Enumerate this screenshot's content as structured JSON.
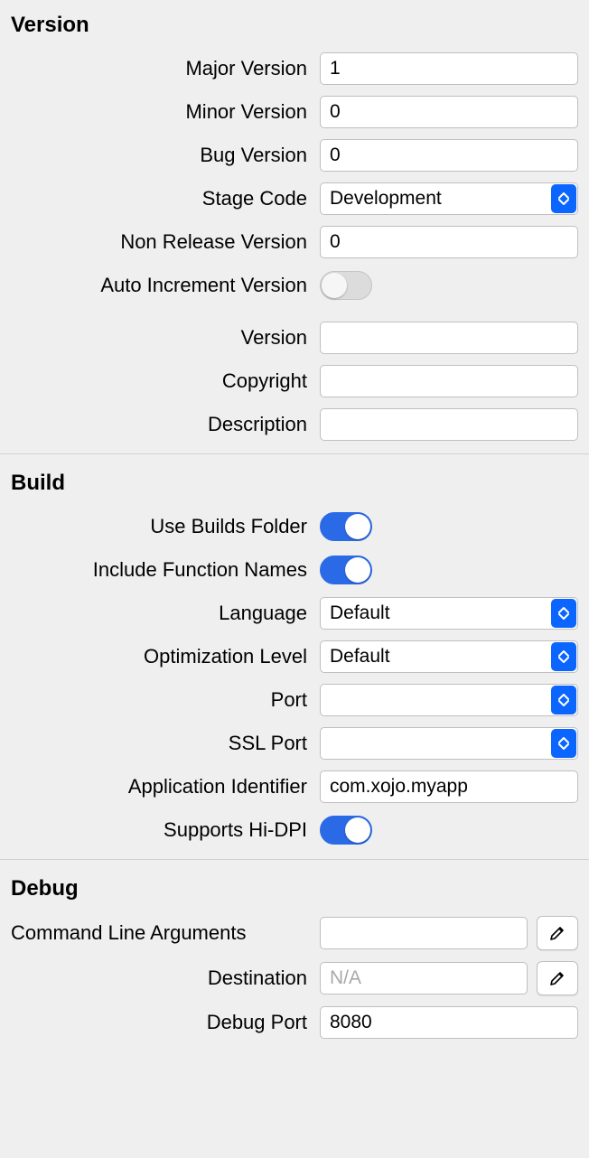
{
  "version": {
    "title": "Version",
    "major_label": "Major Version",
    "major_value": "1",
    "minor_label": "Minor Version",
    "minor_value": "0",
    "bug_label": "Bug Version",
    "bug_value": "0",
    "stage_label": "Stage Code",
    "stage_value": "Development",
    "nonrelease_label": "Non Release Version",
    "nonrelease_value": "0",
    "autoinc_label": "Auto Increment Version",
    "autoinc_on": false,
    "version_label": "Version",
    "version_value": "",
    "copyright_label": "Copyright",
    "copyright_value": "",
    "description_label": "Description",
    "description_value": ""
  },
  "build": {
    "title": "Build",
    "usebuilds_label": "Use Builds Folder",
    "usebuilds_on": true,
    "incfunc_label": "Include Function Names",
    "incfunc_on": true,
    "language_label": "Language",
    "language_value": "Default",
    "opt_label": "Optimization Level",
    "opt_value": "Default",
    "port_label": "Port",
    "port_value": "",
    "sslport_label": "SSL Port",
    "sslport_value": "",
    "appid_label": "Application Identifier",
    "appid_value": "com.xojo.myapp",
    "hidpi_label": "Supports Hi-DPI",
    "hidpi_on": true
  },
  "debug": {
    "title": "Debug",
    "cmdline_label": "Command Line Arguments",
    "cmdline_value": "",
    "dest_label": "Destination",
    "dest_placeholder": "N/A",
    "dest_value": "",
    "debugport_label": "Debug Port",
    "debugport_value": "8080"
  }
}
